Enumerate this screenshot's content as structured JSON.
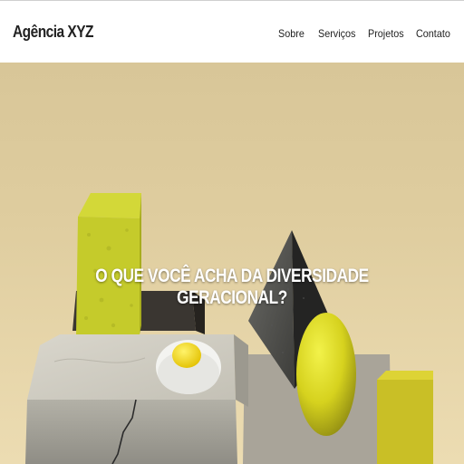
{
  "header": {
    "logo": "Agência XYZ",
    "nav": [
      {
        "label": "Sobre"
      },
      {
        "label": "Serviços"
      },
      {
        "label": "Projetos"
      },
      {
        "label": "Contato"
      }
    ]
  },
  "hero": {
    "headline": "O QUE VOCÊ ACHA DA DIVERSIDADE GERACIONAL?"
  },
  "colors": {
    "background": "#dfcd9f",
    "accent_yellow": "#cfd327",
    "text_dark": "#222222"
  }
}
